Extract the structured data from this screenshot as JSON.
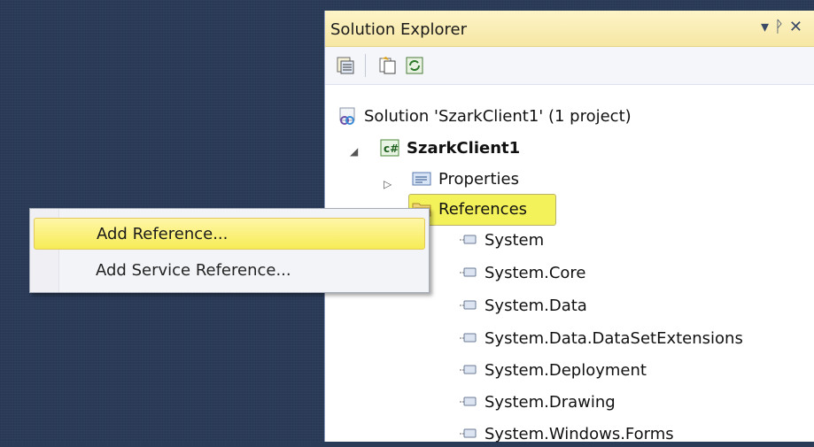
{
  "panel": {
    "title": "Solution Explorer",
    "title_controls": [
      "▾",
      "ᚹ",
      "✕"
    ]
  },
  "tree": {
    "solution": "Solution 'SzarkClient1' (1 project)",
    "project": "SzarkClient1",
    "properties": "Properties",
    "references": "References",
    "ref_items": [
      "System",
      "System.Core",
      "System.Data",
      "System.Data.DataSetExtensions",
      "System.Deployment",
      "System.Drawing",
      "System.Windows.Forms"
    ]
  },
  "context_menu": {
    "items": [
      "Add Reference...",
      "Add Service Reference..."
    ]
  },
  "colors": {
    "highlight": "#f7f34a",
    "background": "#2a3b58"
  }
}
